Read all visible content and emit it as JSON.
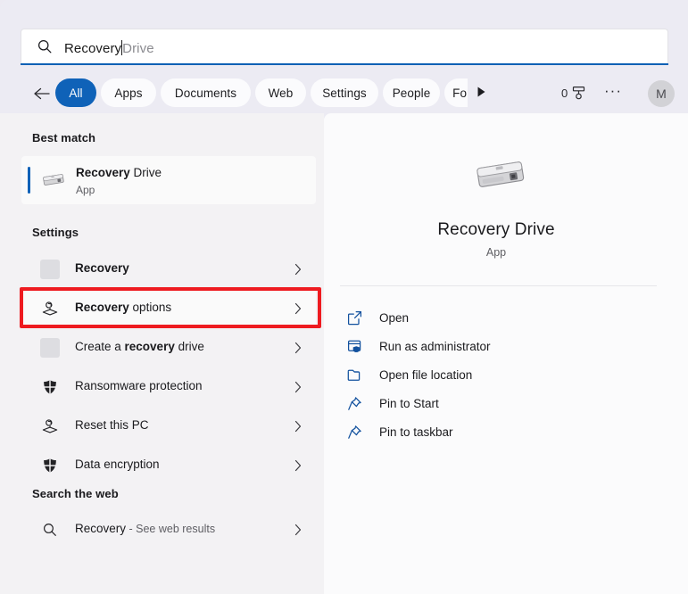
{
  "search": {
    "typed_text": "Recovery",
    "suggestion_text": " Drive",
    "icon": "search-icon"
  },
  "filters": {
    "back_icon": "back-arrow-icon",
    "chips": [
      {
        "label": "All",
        "selected": true
      },
      {
        "label": "Apps",
        "selected": false
      },
      {
        "label": "Documents",
        "selected": false
      },
      {
        "label": "Web",
        "selected": false
      },
      {
        "label": "Settings",
        "selected": false
      },
      {
        "label": "People",
        "selected": false
      },
      {
        "label": "Folders",
        "selected": false
      }
    ],
    "more_icon": "play-triangle-icon",
    "rewards_count": "0",
    "rewards_icon": "rewards-medal-icon",
    "overflow_label": "···",
    "avatar_initial": "M"
  },
  "left_panel": {
    "best_match": {
      "header": "Best match",
      "title_bold": "Recovery",
      "title_rest": " Drive",
      "subtitle": "App",
      "icon": "hard-drive-icon"
    },
    "settings": {
      "header": "Settings",
      "items": [
        {
          "label_bold": "Recovery",
          "label_rest": "",
          "icon": "placeholder-icon",
          "highlighted": false,
          "hovered": false
        },
        {
          "label_bold": "Recovery",
          "label_rest": " options",
          "icon": "recovery-icon",
          "highlighted": true,
          "hovered": true
        },
        {
          "label_bold": "recovery",
          "label_rest": " drive",
          "label_pre": "Create a ",
          "icon": "placeholder-icon",
          "highlighted": false,
          "hovered": false
        },
        {
          "label_bold": "",
          "label_rest": "Ransomware protection",
          "icon": "shield-icon",
          "highlighted": false,
          "hovered": false
        },
        {
          "label_bold": "",
          "label_rest": "Reset this PC",
          "icon": "recovery-icon",
          "highlighted": false,
          "hovered": false
        },
        {
          "label_bold": "",
          "label_rest": "Data encryption",
          "icon": "shield-icon",
          "highlighted": false,
          "hovered": false
        }
      ]
    },
    "web": {
      "header": "Search the web",
      "item": {
        "query_bold": "Recovery",
        "suffix": " - See web results",
        "icon": "search-icon"
      }
    },
    "chevron_icon": "chevron-right-icon"
  },
  "right_panel": {
    "app_icon": "hard-drive-icon",
    "title": "Recovery Drive",
    "subtitle": "App",
    "actions": [
      {
        "label": "Open",
        "icon": "open-external-icon"
      },
      {
        "label": "Run as administrator",
        "icon": "run-as-admin-icon"
      },
      {
        "label": "Open file location",
        "icon": "folder-icon"
      },
      {
        "label": "Pin to Start",
        "icon": "pin-icon"
      },
      {
        "label": "Pin to taskbar",
        "icon": "pin-icon"
      }
    ]
  },
  "colors": {
    "accent_blue": "#0f62b8",
    "annotation_red": "#ee1b20",
    "action_icon_blue": "#12519e",
    "panel_left_bg": "#f3f2f4",
    "panel_right_bg": "#fbfbfc",
    "shell_bg": "#ecebf3"
  }
}
